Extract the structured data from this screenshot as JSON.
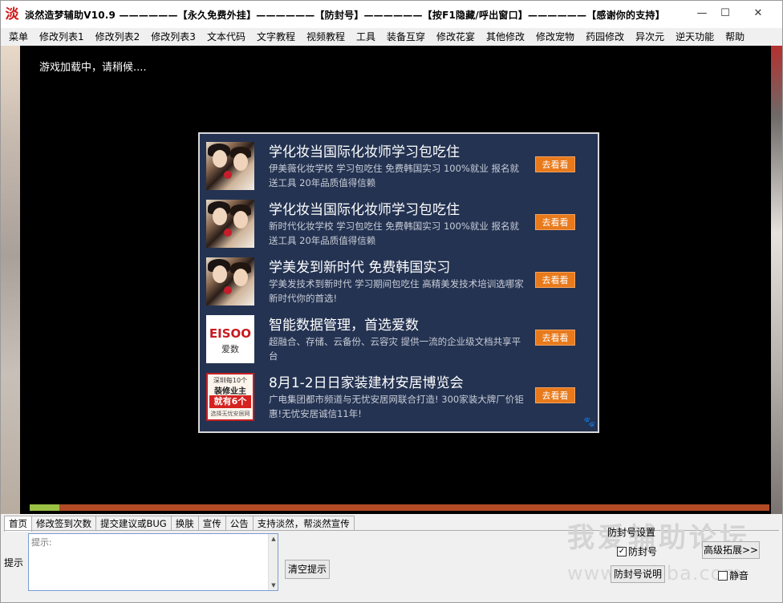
{
  "window": {
    "icon_char": "淡",
    "title": "淡然造梦辅助V10.9 ——————【永久免费外挂】——————【防封号】——————【按F1隐藏/呼出窗口】——————【感谢你的支持】",
    "min_icon": "—",
    "max_icon": "☐",
    "close_icon": "✕"
  },
  "menu": [
    "菜单",
    "修改列表1",
    "修改列表2",
    "修改列表3",
    "文本代码",
    "文字教程",
    "视频教程",
    "工具",
    "装备互穿",
    "修改花宴",
    "其他修改",
    "修改宠物",
    "药园修改",
    "异次元",
    "逆天功能",
    "帮助"
  ],
  "game": {
    "loading_text": "游戏加载中，请稍候....",
    "progress": 0.04
  },
  "ads": [
    {
      "title": "学化妆当国际化妆师学习包吃住",
      "desc": "伊美薇化妆学校 学习包吃住 免费韩国实习 100%就业 报名就送工具 20年品质值得信赖",
      "button": "去看看",
      "thumb": "photo"
    },
    {
      "title": "学化妆当国际化妆师学习包吃住",
      "desc": "新时代化妆学校 学习包吃住 免费韩国实习 100%就业 报名就送工具 20年品质值得信赖",
      "button": "去看看",
      "thumb": "photo"
    },
    {
      "title": "学美发到新时代 免费韩国实习",
      "desc": "学美发技术到新时代 学习期间包吃住 高精美发技术培训选哪家 新时代你的首选!",
      "button": "去看看",
      "thumb": "photo"
    },
    {
      "title": "智能数据管理，首选爱数",
      "desc": "超融合、存储、云备份、云容灾 提供一流的企业级文档共享平台",
      "button": "去看看",
      "thumb": "logo",
      "logo_text": "EISOO",
      "logo_sub": "爱数"
    },
    {
      "title": "8月1-2日日家装建材安居博览会",
      "desc": "广电集团都市频道与无忧安居网联合打造! 300家装大牌厂价钜惠!无忧安居诚信11年!",
      "button": "去看看",
      "thumb": "poster",
      "poster_lines": [
        "深圳每10个",
        "装修业主",
        "就有6个",
        "选择无忧安居网"
      ]
    }
  ],
  "ad_paw_icon": "paw-icon",
  "tabs": [
    "首页",
    "修改签到次数",
    "提交建议或BUG",
    "换肤",
    "宣传",
    "公告",
    "支持淡然，帮淡然宣传"
  ],
  "bottom": {
    "hint_label": "提示",
    "hint_placeholder": "提示:",
    "clear_button": "清空提示",
    "fh_group": "防封号设置",
    "fh_checkbox": "防封号",
    "fh_checked": true,
    "advanced_button": "高级拓展>>",
    "fh_help_button": "防封号说明",
    "mute_checkbox": "静音",
    "mute_checked": false,
    "watermark": "我爱辅助论坛",
    "watermark2": "www.52fzba.com"
  }
}
